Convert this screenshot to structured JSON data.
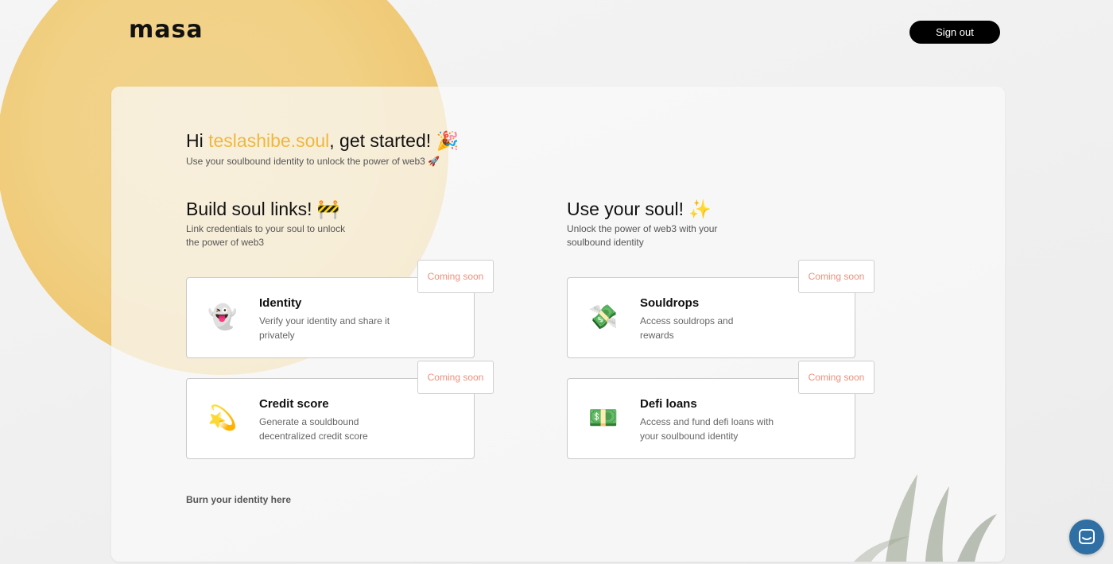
{
  "header": {
    "logo": "masa",
    "signout_label": "Sign out"
  },
  "greeting": {
    "prefix": "Hi ",
    "username": "teslashibe.soul",
    "suffix": ", get started! 🎉",
    "subtitle": "Use your soulbound identity to unlock the power of web3 🚀"
  },
  "sections": {
    "build": {
      "title": "Build soul links! 🚧",
      "desc_line1": "Link credentials to your soul to unlock",
      "desc_line2": "the power of web3"
    },
    "use": {
      "title": "Use your soul! ✨",
      "desc_line1": "Unlock the power of web3 with your",
      "desc_line2": "soulbound identity"
    }
  },
  "cards": {
    "identity": {
      "emoji": "👻",
      "title": "Identity",
      "desc": "Verify your identity and share it privately",
      "badge": "Coming soon"
    },
    "credit": {
      "emoji": "💫",
      "title": "Credit score",
      "desc": "Generate a souldbound decentralized credit score",
      "badge": "Coming soon"
    },
    "souldrops": {
      "emoji": "💸",
      "title": "Souldrops",
      "desc": "Access souldrops and rewards",
      "badge": "Coming soon"
    },
    "defi": {
      "emoji": "💵",
      "title": "Defi loans",
      "desc": "Access and fund defi loans with your soulbound identity",
      "badge": "Coming soon"
    }
  },
  "footer": {
    "burn_label": "Burn your identity here"
  },
  "colors": {
    "accent_username": "#f0b73d",
    "badge_text": "#f08f7b",
    "chat_button": "#2f6fa3"
  }
}
